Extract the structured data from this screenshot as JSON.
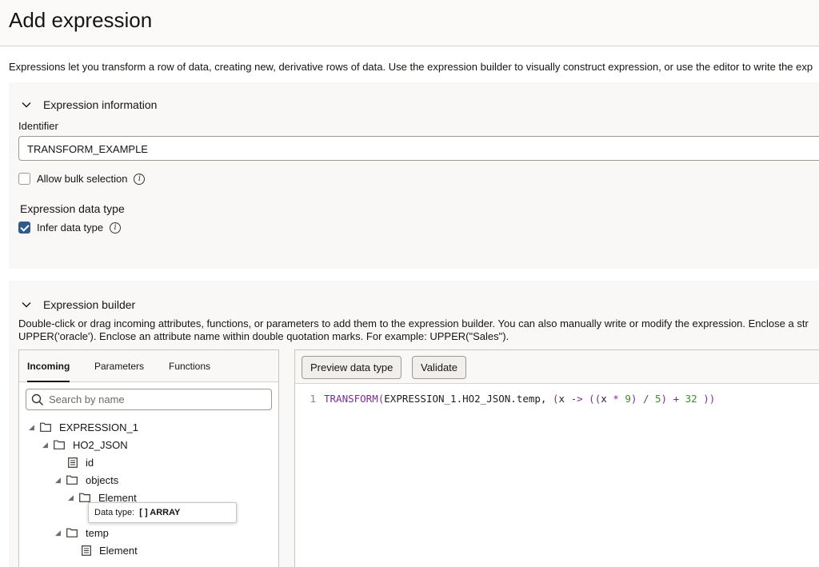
{
  "page": {
    "title": "Add expression",
    "intro": "Expressions let you transform a row of data, creating new, derivative rows of data. Use the expression builder to visually construct expression, or use the editor to write the exp"
  },
  "info_section": {
    "header": "Expression information",
    "identifier_label": "Identifier",
    "identifier_value": "TRANSFORM_EXAMPLE",
    "allow_bulk_label": "Allow bulk selection",
    "allow_bulk_checked": false,
    "data_type_heading": "Expression data type",
    "infer_label": "Infer data type",
    "infer_checked": true
  },
  "builder_section": {
    "header": "Expression builder",
    "desc_line1": "Double-click or drag incoming attributes, functions, or parameters to add them to the expression builder. You can also manually write or modify the expression. Enclose a str",
    "desc_line2": "UPPER('oracle'). Enclose an attribute name within double quotation marks. For example: UPPER(\"Sales\").",
    "tabs": [
      "Incoming",
      "Parameters",
      "Functions"
    ],
    "active_tab": "Incoming",
    "search_placeholder": "Search by name",
    "tree": [
      {
        "label": "EXPRESSION_1",
        "type": "folder"
      },
      {
        "label": "HO2_JSON",
        "type": "folder"
      },
      {
        "label": "id",
        "type": "attribute"
      },
      {
        "label": "objects",
        "type": "folder"
      },
      {
        "label": "Element",
        "type": "folder"
      },
      {
        "label": "temp",
        "type": "folder"
      },
      {
        "label": "Element",
        "type": "attribute"
      }
    ],
    "tooltip": {
      "prefix": "Data type:",
      "value": "[ ] ARRAY"
    },
    "buttons": {
      "preview": "Preview data type",
      "validate": "Validate"
    },
    "code": {
      "line_number": "1",
      "fn": "TRANSFORM",
      "open": "(",
      "path": "EXPRESSION_1.HO2_JSON.temp, ",
      "p1": "(",
      "var": "x ",
      "arrow": "->",
      "p2": " ((",
      "var2": "x ",
      "mul": "*",
      "n9": " 9",
      "p3": ") ",
      "div": "/",
      "n5": " 5",
      "p4": ") ",
      "plus": "+",
      "n32": " 32",
      "close": " ))"
    }
  },
  "colors": {
    "checkbox_checked": "#2f5b8c",
    "keyword": "#7b2d8e",
    "number": "#3c8a2e"
  }
}
